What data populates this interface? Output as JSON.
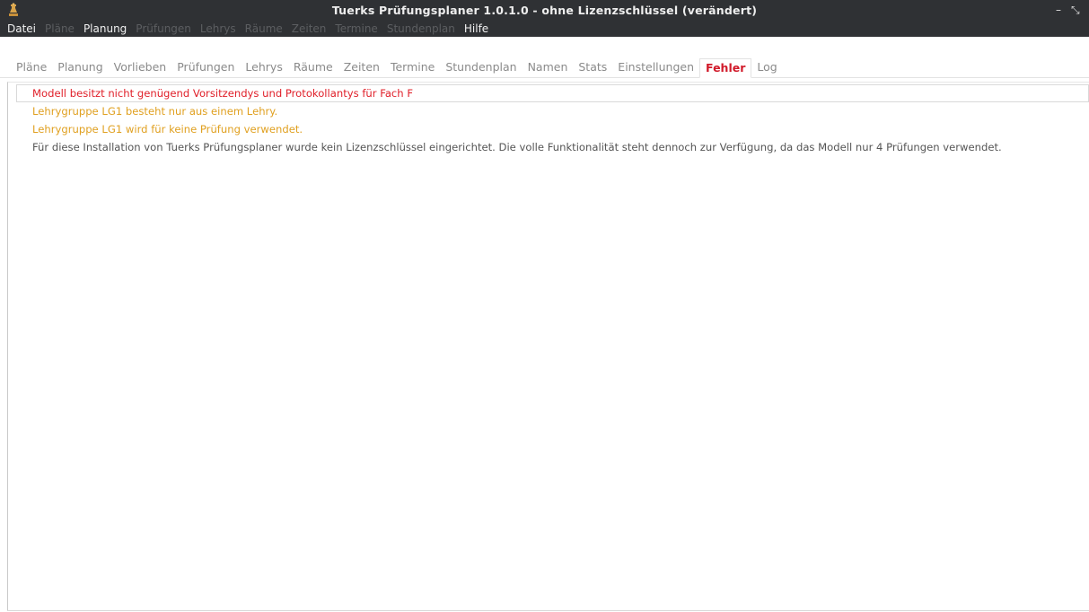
{
  "window": {
    "title": "Tuerks Prüfungsplaner 1.0.1.0 - ohne Lizenzschlüssel (verändert)",
    "minimize_glyph": "–",
    "restore_glyph": "⤡",
    "icon": "app-chess-icon"
  },
  "menubar": {
    "items": [
      {
        "label": "Datei",
        "enabled": true
      },
      {
        "label": "Pläne",
        "enabled": false
      },
      {
        "label": "Planung",
        "enabled": true
      },
      {
        "label": "Prüfungen",
        "enabled": false
      },
      {
        "label": "Lehrys",
        "enabled": false
      },
      {
        "label": "Räume",
        "enabled": false
      },
      {
        "label": "Zeiten",
        "enabled": false
      },
      {
        "label": "Termine",
        "enabled": false
      },
      {
        "label": "Stundenplan",
        "enabled": false
      },
      {
        "label": "Hilfe",
        "enabled": true
      }
    ]
  },
  "tabs": [
    {
      "label": "Pläne",
      "active": false
    },
    {
      "label": "Planung",
      "active": false
    },
    {
      "label": "Vorlieben",
      "active": false
    },
    {
      "label": "Prüfungen",
      "active": false
    },
    {
      "label": "Lehrys",
      "active": false
    },
    {
      "label": "Räume",
      "active": false
    },
    {
      "label": "Zeiten",
      "active": false
    },
    {
      "label": "Termine",
      "active": false
    },
    {
      "label": "Stundenplan",
      "active": false
    },
    {
      "label": "Namen",
      "active": false
    },
    {
      "label": "Stats",
      "active": false
    },
    {
      "label": "Einstellungen",
      "active": false
    },
    {
      "label": "Fehler",
      "active": true
    },
    {
      "label": "Log",
      "active": false
    }
  ],
  "messages": [
    {
      "text": "Modell besitzt nicht genügend Vorsitzendys und Protokollantys für Fach F",
      "level": "error",
      "color": "#e0202a"
    },
    {
      "text": "Lehrygruppe LG1 besteht nur aus einem Lehry.",
      "level": "warning",
      "color": "#e0a020"
    },
    {
      "text": "Lehrygruppe LG1 wird für keine Prüfung verwendet.",
      "level": "warning",
      "color": "#e0a020"
    },
    {
      "text": "Für diese Installation von Tuerks Prüfungsplaner wurde kein Lizenzschlüssel eingerichtet. Die volle Funktionalität steht dennoch zur Verfügung, da das Modell nur 4 Prüfungen verwendet.",
      "level": "info",
      "color": "#555555"
    }
  ],
  "colors": {
    "titlebar_bg": "#2f3134",
    "active_tab": "#d11a2a",
    "inactive_tab": "#8a8a8a"
  }
}
